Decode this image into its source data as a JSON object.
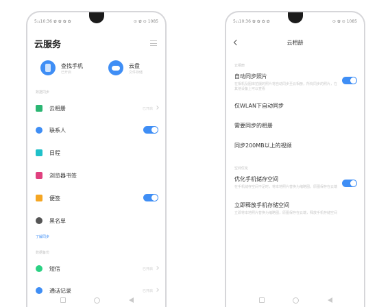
{
  "left_screen": {
    "status": {
      "time": "5₁₁10:36 ✿ ✿ ✿ ✿",
      "right": "⊙ ✿ ⊙ 1085"
    },
    "title": "云服务",
    "quick_cards": [
      {
        "label": "查找手机",
        "sub": "已开启",
        "icon": "phone-finder-icon"
      },
      {
        "label": "云盘",
        "sub": "文件存储",
        "icon": "cloud-icon"
      }
    ],
    "sections": {
      "data_sync": "数据同步",
      "learn_sync": "了解同步",
      "data_backup": "数据备份"
    },
    "items": [
      {
        "label": "云相册",
        "status": "已开启",
        "icon": "gallery-icon",
        "color": "#2bb673",
        "toggle": false
      },
      {
        "label": "联系人",
        "status": "",
        "icon": "contacts-icon",
        "color": "#3f8ef5",
        "toggle": true
      },
      {
        "label": "日程",
        "status": "",
        "icon": "calendar-icon",
        "color": "#1fc0c9",
        "toggle": false
      },
      {
        "label": "浏览器书签",
        "status": "",
        "icon": "bookmark-icon",
        "color": "#e0417f",
        "toggle": false
      },
      {
        "label": "便签",
        "status": "",
        "icon": "notes-icon",
        "color": "#f5a623",
        "toggle": true
      },
      {
        "label": "黑名单",
        "status": "",
        "icon": "blacklist-icon",
        "color": "#555555",
        "toggle": false
      },
      {
        "label": "短信",
        "status": "已开启",
        "icon": "sms-icon",
        "color": "#2bd183",
        "toggle": false
      },
      {
        "label": "通话记录",
        "status": "已开启",
        "icon": "call-log-icon",
        "color": "#3f8ef5",
        "toggle": false
      }
    ]
  },
  "right_screen": {
    "status": {
      "time": "5₁₁10:36 ✿ ✿ ✿ ✿",
      "right": "⊙ ✿ ⊙ 1085"
    },
    "title": "云相册",
    "sections": {
      "album": "云相册",
      "storage": "空间优化"
    },
    "items": [
      {
        "label": "自动同步照片",
        "sub": "在相机及图库拍摄的照片将自动同步至云相册，所有同步的照片，在其他设备上可以查看",
        "toggle": true
      },
      {
        "label": "仅WLAN下自动同步",
        "sub": "",
        "toggle": false
      },
      {
        "label": "需要同步的相册",
        "sub": "",
        "toggle": false
      },
      {
        "label": "同步200MB以上的视频",
        "sub": "",
        "toggle": false
      },
      {
        "label": "优化手机储存空间",
        "sub": "在手机储存空间不足时，将本地照片替换为缩略图，原图保存在云端",
        "toggle": true
      },
      {
        "label": "立即释放手机存储空间",
        "sub": "立即将本地照片替换为缩略图，原图保存在云端，释放手机存储空间",
        "toggle": false
      }
    ]
  },
  "colors": {
    "accent": "#3f8ef5"
  }
}
